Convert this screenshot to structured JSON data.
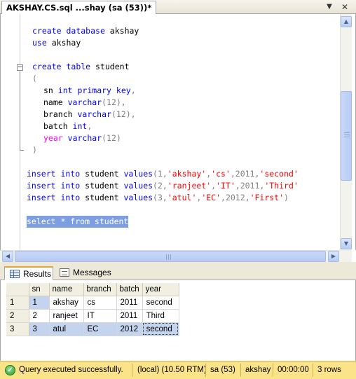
{
  "document_tab": {
    "title": "AKSHAY.CS.sql ...shay (sa (53))*",
    "dropdown_glyph": "▼",
    "close_glyph": "✕"
  },
  "editor": {
    "collapse_glyph": "−",
    "lines": [
      {
        "tokens": [
          {
            "text": "create",
            "type": "kw"
          },
          {
            "text": " ",
            "type": "plain"
          },
          {
            "text": "database",
            "type": "kw"
          },
          {
            "text": " akshay",
            "type": "plain"
          }
        ]
      },
      {
        "tokens": [
          {
            "text": "use",
            "type": "kw"
          },
          {
            "text": " akshay",
            "type": "plain"
          }
        ]
      },
      {
        "tokens": [
          {
            "text": "create",
            "type": "kw"
          },
          {
            "text": " ",
            "type": "plain"
          },
          {
            "text": "table",
            "type": "kw"
          },
          {
            "text": " student",
            "type": "plain"
          }
        ]
      },
      {
        "tokens": [
          {
            "text": "(",
            "type": "gray"
          }
        ]
      },
      {
        "tokens": [
          {
            "text": "sn ",
            "type": "plain"
          },
          {
            "text": "int",
            "type": "kw"
          },
          {
            "text": " ",
            "type": "plain"
          },
          {
            "text": "primary",
            "type": "kw"
          },
          {
            "text": " ",
            "type": "plain"
          },
          {
            "text": "key",
            "type": "kw"
          },
          {
            "text": ",",
            "type": "gray"
          }
        ]
      },
      {
        "tokens": [
          {
            "text": "name ",
            "type": "plain"
          },
          {
            "text": "varchar",
            "type": "kw"
          },
          {
            "text": "(12),",
            "type": "gray"
          }
        ]
      },
      {
        "tokens": [
          {
            "text": "branch ",
            "type": "plain"
          },
          {
            "text": "varchar",
            "type": "kw"
          },
          {
            "text": "(12),",
            "type": "gray"
          }
        ]
      },
      {
        "tokens": [
          {
            "text": "batch ",
            "type": "plain"
          },
          {
            "text": "int",
            "type": "kw"
          },
          {
            "text": ",",
            "type": "gray"
          }
        ]
      },
      {
        "tokens": [
          {
            "text": "year",
            "type": "pink"
          },
          {
            "text": " ",
            "type": "plain"
          },
          {
            "text": "varchar",
            "type": "kw"
          },
          {
            "text": "(12)",
            "type": "gray"
          }
        ]
      },
      {
        "tokens": [
          {
            "text": ")",
            "type": "gray"
          }
        ]
      },
      {
        "tokens": [
          {
            "text": "insert",
            "type": "kw"
          },
          {
            "text": " ",
            "type": "plain"
          },
          {
            "text": "into",
            "type": "kw"
          },
          {
            "text": " student ",
            "type": "plain"
          },
          {
            "text": "values",
            "type": "kw"
          },
          {
            "text": "(1,",
            "type": "gray"
          },
          {
            "text": "'akshay'",
            "type": "str"
          },
          {
            "text": ",",
            "type": "gray"
          },
          {
            "text": "'cs'",
            "type": "str"
          },
          {
            "text": ",2011,",
            "type": "gray"
          },
          {
            "text": "'second'",
            "type": "str"
          }
        ]
      },
      {
        "tokens": [
          {
            "text": "insert",
            "type": "kw"
          },
          {
            "text": " ",
            "type": "plain"
          },
          {
            "text": "into",
            "type": "kw"
          },
          {
            "text": " student ",
            "type": "plain"
          },
          {
            "text": "values",
            "type": "kw"
          },
          {
            "text": "(2,",
            "type": "gray"
          },
          {
            "text": "'ranjeet'",
            "type": "str"
          },
          {
            "text": ",",
            "type": "gray"
          },
          {
            "text": "'IT'",
            "type": "str"
          },
          {
            "text": ",2011,",
            "type": "gray"
          },
          {
            "text": "'Third'",
            "type": "str"
          }
        ]
      },
      {
        "tokens": [
          {
            "text": "insert",
            "type": "kw"
          },
          {
            "text": " ",
            "type": "plain"
          },
          {
            "text": "into",
            "type": "kw"
          },
          {
            "text": " student ",
            "type": "plain"
          },
          {
            "text": "values",
            "type": "kw"
          },
          {
            "text": "(3,",
            "type": "gray"
          },
          {
            "text": "'atul'",
            "type": "str"
          },
          {
            "text": ",",
            "type": "gray"
          },
          {
            "text": "'EC'",
            "type": "str"
          },
          {
            "text": ",2012,",
            "type": "gray"
          },
          {
            "text": "'First'",
            "type": "str"
          },
          {
            "text": ")",
            "type": "gray"
          }
        ]
      },
      {
        "tokens": [
          {
            "text": "select * from student",
            "type": "plain"
          }
        ],
        "selected": true
      }
    ],
    "colors": {
      "keyword": "#0000ff",
      "string": "#ff0000",
      "operator": "#808080",
      "function": "#ff00ff",
      "selection": "#7d9ee0"
    }
  },
  "scrollbars": {
    "up_glyph": "▲",
    "down_glyph": "▼",
    "left_glyph": "◀",
    "right_glyph": "▶"
  },
  "result_tabs": {
    "results_label": "Results",
    "messages_label": "Messages"
  },
  "grid": {
    "columns": [
      "sn",
      "name",
      "branch",
      "batch",
      "year"
    ],
    "rows": [
      {
        "row_number": "1",
        "cells": [
          "1",
          "akshay",
          "cs",
          "2011",
          "second"
        ]
      },
      {
        "row_number": "2",
        "cells": [
          "2",
          "ranjeet",
          "IT",
          "2011",
          "Third"
        ]
      },
      {
        "row_number": "3",
        "cells": [
          "3",
          "atul",
          "EC",
          "2012",
          "second"
        ],
        "selected": true
      }
    ]
  },
  "status_bar": {
    "ok_glyph": "✓",
    "message": "Query executed successfully.",
    "server": "(local) (10.50 RTM)",
    "login": "sa (53)",
    "database": "akshay",
    "elapsed": "00:00:00",
    "row_count": "3 rows",
    "background": "#fbe38a"
  }
}
